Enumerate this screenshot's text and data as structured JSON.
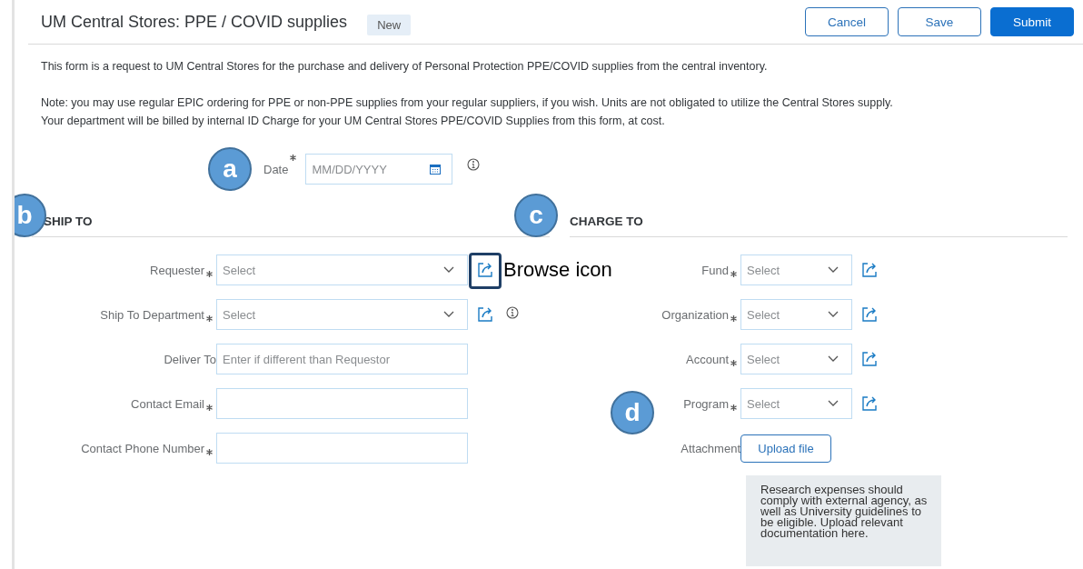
{
  "header": {
    "title": "UM Central Stores: PPE / COVID supplies",
    "status": "New"
  },
  "actions": [
    {
      "label": "Cancel",
      "kind": "secondary"
    },
    {
      "label": "Save",
      "kind": "secondary"
    },
    {
      "label": "Submit",
      "kind": "primary"
    }
  ],
  "intro": "This form is a request to UM Central Stores for the purchase and delivery of Personal Protection PPE/COVID supplies from the central inventory.",
  "note_lines": [
    "Note: you may use regular EPIC ordering for PPE or non-PPE supplies from your regular suppliers, if you wish.  Units are not obligated to utilize the Central Stores supply.",
    "Your department will be billed by internal ID Charge for your UM Central Stores PPE/COVID Supplies from this form, at cost."
  ],
  "date": {
    "label": "Date",
    "required": true,
    "placeholder": "MM/DD/YYYY",
    "info": true,
    "callout": "a"
  },
  "ship_to": {
    "heading": "SHIP TO",
    "callout": "b",
    "fields": [
      {
        "label": "Requester",
        "required": true,
        "kind": "select",
        "placeholder": "Select",
        "browse": true,
        "info": false,
        "annotation": "Browse icon"
      },
      {
        "label": "Ship To Department",
        "required": true,
        "kind": "select",
        "placeholder": "Select",
        "browse": true,
        "info": true
      },
      {
        "label": "Deliver To",
        "required": false,
        "kind": "text",
        "placeholder": "Enter if different than Requestor",
        "browse": false,
        "info": false
      },
      {
        "label": "Contact Email",
        "required": true,
        "kind": "text",
        "browse": false,
        "info": false
      },
      {
        "label": "Contact Phone Number",
        "required": true,
        "kind": "text",
        "browse": false,
        "info": false
      }
    ]
  },
  "charge_to": {
    "heading": "CHARGE TO",
    "callout": "c",
    "fields": [
      {
        "label": "Fund",
        "required": true,
        "kind": "select",
        "placeholder": "Select",
        "browse": true,
        "info": false
      },
      {
        "label": "Organization",
        "required": true,
        "kind": "select",
        "placeholder": "Select",
        "browse": true,
        "info": false
      },
      {
        "label": "Account",
        "required": true,
        "kind": "select",
        "placeholder": "Select",
        "browse": true,
        "info": false
      },
      {
        "label": "Program",
        "required": true,
        "kind": "select",
        "placeholder": "Select",
        "browse": true,
        "info": false,
        "callout": "d"
      },
      {
        "label": "Attachment",
        "required": false,
        "kind": "upload",
        "button": "Upload file",
        "browse": false,
        "info": false
      }
    ],
    "note": "Research expenses should comply with external agency, as well as University guidelines to be eligible. Upload relevant documentation here."
  }
}
